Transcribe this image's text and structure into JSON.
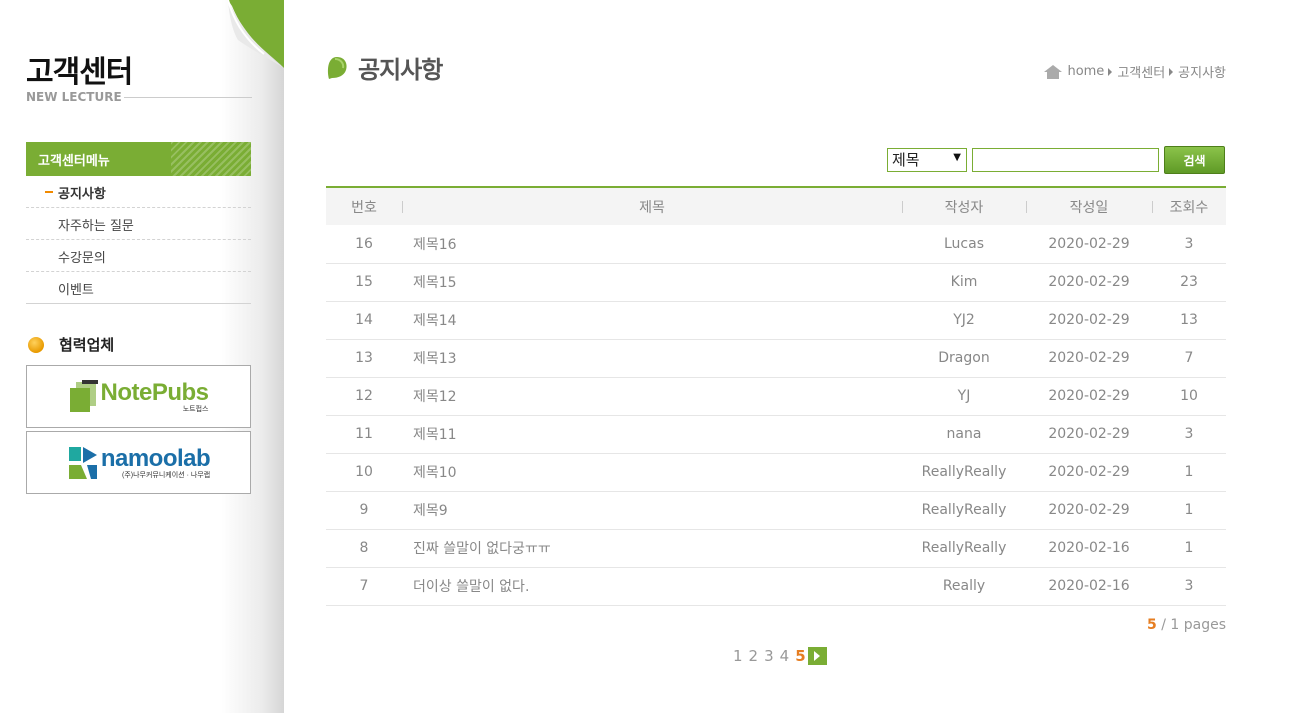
{
  "sidebar": {
    "title": "고객센터",
    "subtitle": "NEW LECTURE",
    "menu_header": "고객센터메뉴",
    "items": [
      {
        "label": "공지사항"
      },
      {
        "label": "자주하는 질문"
      },
      {
        "label": "수강문의"
      },
      {
        "label": "이벤트"
      }
    ],
    "partners_title": "협력업체",
    "partners": [
      {
        "name": "NotePubs",
        "sub": "노트펍스"
      },
      {
        "name": "namoolab",
        "sub": "(주)나무커뮤니케이션 · 나무랩"
      }
    ]
  },
  "main": {
    "title": "공지사항",
    "breadcrumb": [
      "home",
      "고객센터",
      "공지사항"
    ],
    "search": {
      "selected_option": "제목",
      "input_value": "",
      "button_label": "검색"
    },
    "table": {
      "headers": [
        "번호",
        "제목",
        "작성자",
        "작성일",
        "조회수"
      ],
      "rows": [
        [
          "16",
          "제목16",
          "Lucas",
          "2020-02-29",
          "3"
        ],
        [
          "15",
          "제목15",
          "Kim",
          "2020-02-29",
          "23"
        ],
        [
          "14",
          "제목14",
          "YJ2",
          "2020-02-29",
          "13"
        ],
        [
          "13",
          "제목13",
          "Dragon",
          "2020-02-29",
          "7"
        ],
        [
          "12",
          "제목12",
          "YJ",
          "2020-02-29",
          "10"
        ],
        [
          "11",
          "제목11",
          "nana",
          "2020-02-29",
          "3"
        ],
        [
          "10",
          "제목10",
          "ReallyReally",
          "2020-02-29",
          "1"
        ],
        [
          "9",
          "제목9",
          "ReallyReally",
          "2020-02-29",
          "1"
        ],
        [
          "8",
          "진짜 쓸말이 없다궁ㅠㅠ",
          "ReallyReally",
          "2020-02-16",
          "1"
        ],
        [
          "7",
          "더이상 쓸말이 없다.",
          "Really",
          "2020-02-16",
          "3"
        ]
      ]
    },
    "pages_info": {
      "current": "5",
      "rest": "/ 1 pages"
    },
    "pagination": {
      "pages": [
        "1",
        "2",
        "3",
        "4"
      ],
      "current": "5"
    }
  },
  "colors": {
    "accent": "#7aad34",
    "highlight": "#e67e22"
  }
}
